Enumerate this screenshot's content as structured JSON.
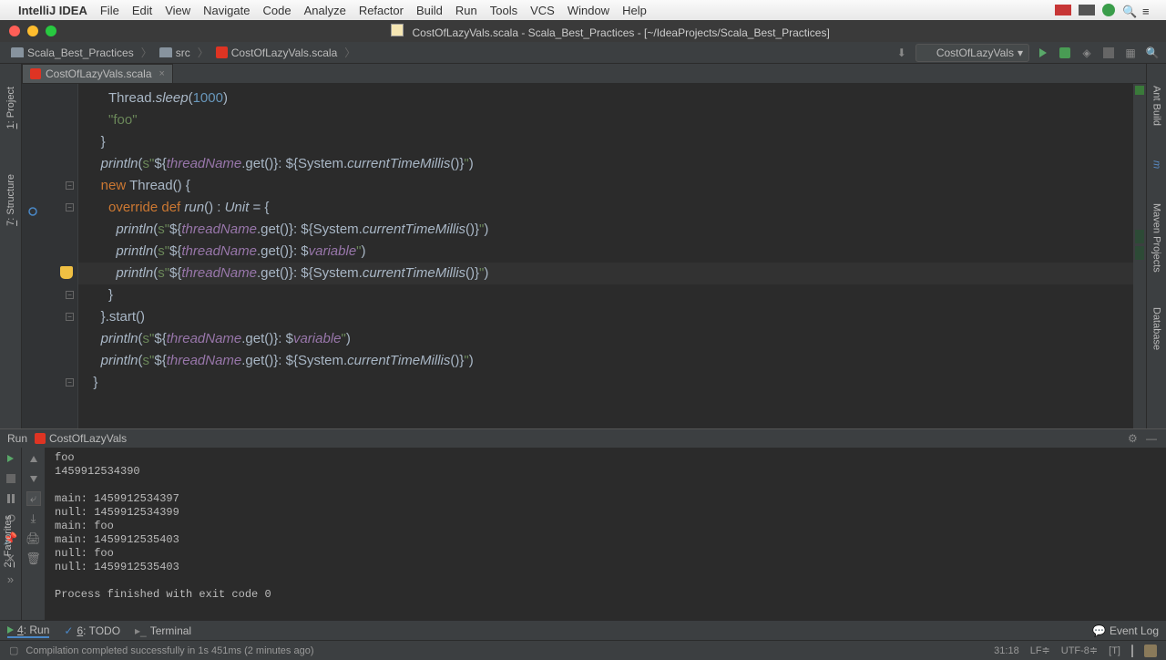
{
  "menubar": {
    "app": "IntelliJ IDEA",
    "items": [
      "File",
      "Edit",
      "View",
      "Navigate",
      "Code",
      "Analyze",
      "Refactor",
      "Build",
      "Run",
      "Tools",
      "VCS",
      "Window",
      "Help"
    ]
  },
  "titlebar": {
    "title": "CostOfLazyVals.scala - Scala_Best_Practices - [~/IdeaProjects/Scala_Best_Practices]"
  },
  "breadcrumbs": {
    "project": "Scala_Best_Practices",
    "folder": "src",
    "file": "CostOfLazyVals.scala"
  },
  "run_config": "CostOfLazyVals",
  "tab": {
    "name": "CostOfLazyVals.scala"
  },
  "left_tabs": {
    "project": "1: Project",
    "structure": "7: Structure",
    "favorites": "2: Favorites"
  },
  "right_tabs": {
    "ant": "Ant Build",
    "maven": "Maven Projects",
    "database": "Database"
  },
  "code_lines": [
    {
      "indent": "      ",
      "tokens": [
        {
          "t": "Thread.",
          "c": "sys"
        },
        {
          "t": "sleep",
          "c": "fn"
        },
        {
          "t": "(",
          "c": "sys"
        },
        {
          "t": "1000",
          "c": "num"
        },
        {
          "t": ")",
          "c": "sys"
        }
      ]
    },
    {
      "indent": "      ",
      "tokens": [
        {
          "t": "\"foo\"",
          "c": "str"
        }
      ]
    },
    {
      "indent": "    ",
      "tokens": [
        {
          "t": "}",
          "c": "sys"
        }
      ]
    },
    {
      "indent": "    ",
      "tokens": [
        {
          "t": "println",
          "c": "fn"
        },
        {
          "t": "(",
          "c": "sys"
        },
        {
          "t": "s",
          "c": "str"
        },
        {
          "t": "\"",
          "c": "str"
        },
        {
          "t": "${",
          "c": "sys"
        },
        {
          "t": "threadName",
          "c": "ref"
        },
        {
          "t": ".get()}: ${System.",
          "c": "sys"
        },
        {
          "t": "currentTimeMillis",
          "c": "fn"
        },
        {
          "t": "()}",
          "c": "sys"
        },
        {
          "t": "\"",
          "c": "str"
        },
        {
          "t": ")",
          "c": "sys"
        }
      ]
    },
    {
      "indent": "    ",
      "tokens": [
        {
          "t": "new ",
          "c": "kw1"
        },
        {
          "t": "Thread() {",
          "c": "sys"
        }
      ]
    },
    {
      "indent": "      ",
      "tokens": [
        {
          "t": "override ",
          "c": "kw1"
        },
        {
          "t": "def ",
          "c": "kw1"
        },
        {
          "t": "run",
          "c": "typ"
        },
        {
          "t": "() : ",
          "c": "sys"
        },
        {
          "t": "Unit",
          "c": "typ"
        },
        {
          "t": " = {",
          "c": "sys"
        }
      ]
    },
    {
      "indent": "        ",
      "tokens": [
        {
          "t": "println",
          "c": "fn"
        },
        {
          "t": "(",
          "c": "sys"
        },
        {
          "t": "s",
          "c": "str"
        },
        {
          "t": "\"",
          "c": "str"
        },
        {
          "t": "${",
          "c": "sys"
        },
        {
          "t": "threadName",
          "c": "ref"
        },
        {
          "t": ".get()}: ${System.",
          "c": "sys"
        },
        {
          "t": "currentTimeMillis",
          "c": "fn"
        },
        {
          "t": "()}",
          "c": "sys"
        },
        {
          "t": "\"",
          "c": "str"
        },
        {
          "t": ")",
          "c": "sys"
        }
      ]
    },
    {
      "indent": "        ",
      "tokens": [
        {
          "t": "println",
          "c": "fn"
        },
        {
          "t": "(",
          "c": "sys"
        },
        {
          "t": "s",
          "c": "str"
        },
        {
          "t": "\"",
          "c": "str"
        },
        {
          "t": "${",
          "c": "sys"
        },
        {
          "t": "threadName",
          "c": "ref"
        },
        {
          "t": ".get()}: $",
          "c": "sys"
        },
        {
          "t": "variable",
          "c": "ref"
        },
        {
          "t": "\"",
          "c": "str"
        },
        {
          "t": ")",
          "c": "sys"
        }
      ]
    },
    {
      "indent": "        ",
      "tokens": [
        {
          "t": "println",
          "c": "fn"
        },
        {
          "t": "(",
          "c": "sys"
        },
        {
          "t": "s",
          "c": "str"
        },
        {
          "t": "\"",
          "c": "str"
        },
        {
          "t": "${",
          "c": "sys"
        },
        {
          "t": "threadName",
          "c": "ref"
        },
        {
          "t": ".get()}: ${System.",
          "c": "sys"
        },
        {
          "t": "currentTimeMillis",
          "c": "fn"
        },
        {
          "t": "()}",
          "c": "sys"
        },
        {
          "t": "\"",
          "c": "str"
        },
        {
          "t": ")",
          "c": "sys"
        }
      ],
      "hl": true,
      "bulb": true
    },
    {
      "indent": "      ",
      "tokens": [
        {
          "t": "}",
          "c": "sys"
        }
      ]
    },
    {
      "indent": "    ",
      "tokens": [
        {
          "t": "}.start()",
          "c": "sys"
        }
      ]
    },
    {
      "indent": "    ",
      "tokens": [
        {
          "t": "println",
          "c": "fn"
        },
        {
          "t": "(",
          "c": "sys"
        },
        {
          "t": "s",
          "c": "str"
        },
        {
          "t": "\"",
          "c": "str"
        },
        {
          "t": "${",
          "c": "sys"
        },
        {
          "t": "threadName",
          "c": "ref"
        },
        {
          "t": ".get()}: $",
          "c": "sys"
        },
        {
          "t": "variable",
          "c": "ref"
        },
        {
          "t": "\"",
          "c": "str"
        },
        {
          "t": ")",
          "c": "sys"
        }
      ]
    },
    {
      "indent": "    ",
      "tokens": [
        {
          "t": "println",
          "c": "fn"
        },
        {
          "t": "(",
          "c": "sys"
        },
        {
          "t": "s",
          "c": "str"
        },
        {
          "t": "\"",
          "c": "str"
        },
        {
          "t": "${",
          "c": "sys"
        },
        {
          "t": "threadName",
          "c": "ref"
        },
        {
          "t": ".get()}: ${System.",
          "c": "sys"
        },
        {
          "t": "currentTimeMillis",
          "c": "fn"
        },
        {
          "t": "()}",
          "c": "sys"
        },
        {
          "t": "\"",
          "c": "str"
        },
        {
          "t": ")",
          "c": "sys"
        }
      ]
    },
    {
      "indent": "  ",
      "tokens": [
        {
          "t": "}",
          "c": "sys"
        }
      ]
    }
  ],
  "run_panel": {
    "label_run": "Run",
    "label_config": "CostOfLazyVals",
    "output": "foo\n1459912534390\n\nmain: 1459912534397\nnull: 1459912534399\nmain: foo\nmain: 1459912535403\nnull: foo\nnull: 1459912535403\n\nProcess finished with exit code 0"
  },
  "bottom": {
    "run": "4: Run",
    "todo": "6: TODO",
    "terminal": "Terminal",
    "eventlog": "Event Log"
  },
  "status": {
    "msg": "Compilation completed successfully in 1s 451ms (2 minutes ago)",
    "pos": "31:18",
    "lf": "LF≑",
    "enc": "UTF-8≑",
    "ins": "[T]"
  }
}
